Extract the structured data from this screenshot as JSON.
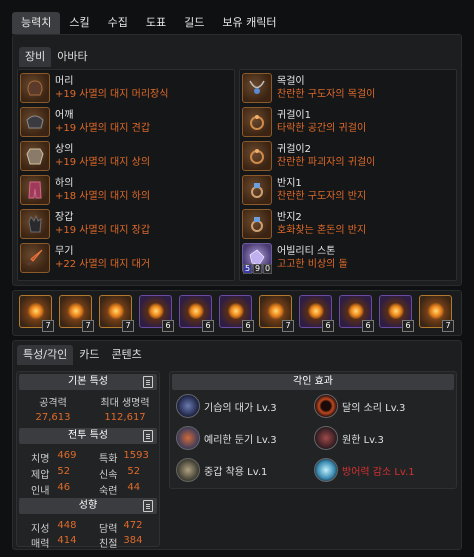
{
  "top_tabs": [
    "능력치",
    "스킬",
    "수집",
    "도표",
    "길드",
    "보유 캐릭터"
  ],
  "equip_tabs": [
    "장비",
    "아바타"
  ],
  "equipment_left": [
    {
      "name": "머리",
      "desc": "+19 사멸의 대지 머리장식",
      "icon": "helmet-icon"
    },
    {
      "name": "어깨",
      "desc": "+19 사멸의 대지 견갑",
      "icon": "shoulder-icon"
    },
    {
      "name": "상의",
      "desc": "+19 사멸의 대지 상의",
      "icon": "chest-armor-icon"
    },
    {
      "name": "하의",
      "desc": "+18 사멸의 대지 하의",
      "icon": "pants-icon"
    },
    {
      "name": "장갑",
      "desc": "+19 사멸의 대지 장갑",
      "icon": "gloves-icon"
    },
    {
      "name": "무기",
      "desc": "+22 사멸의 대지 대거",
      "icon": "dagger-icon"
    }
  ],
  "equipment_right": [
    {
      "name": "목걸이",
      "desc": "찬란한 구도자의 목걸이",
      "icon": "necklace-icon"
    },
    {
      "name": "귀걸이1",
      "desc": "타락한 공간의 귀걸이",
      "icon": "earring-icon"
    },
    {
      "name": "귀걸이2",
      "desc": "찬란한 파괴자의 귀걸이",
      "icon": "earring-icon"
    },
    {
      "name": "반지1",
      "desc": "찬란한 구도자의 반지",
      "icon": "ring-icon"
    },
    {
      "name": "반지2",
      "desc": "호화찾는 혼돈의 반지",
      "icon": "ring-icon"
    },
    {
      "name": "어빌리티 스톤",
      "desc": "고고한 비상의 돌",
      "icon": "ability-stone-icon",
      "badges": [
        "5",
        "9",
        "0"
      ]
    }
  ],
  "gems": [
    {
      "level": "7",
      "color": "orange"
    },
    {
      "level": "7",
      "color": "orange"
    },
    {
      "level": "7",
      "color": "orange"
    },
    {
      "level": "6",
      "color": "purple"
    },
    {
      "level": "6",
      "color": "purple"
    },
    {
      "level": "6",
      "color": "purple"
    },
    {
      "level": "7",
      "color": "orange"
    },
    {
      "level": "6",
      "color": "purple"
    },
    {
      "level": "6",
      "color": "purple"
    },
    {
      "level": "6",
      "color": "purple"
    },
    {
      "level": "7",
      "color": "orange"
    }
  ],
  "bottom_tabs": [
    "특성/각인",
    "카드",
    "콘텐츠"
  ],
  "basic_stats": {
    "title": "기본 특성",
    "attack_label": "공격력",
    "attack_value": "27,613",
    "hp_label": "최대 생명력",
    "hp_value": "112,617"
  },
  "combat_stats": {
    "title": "전투 특성",
    "items": [
      {
        "label": "치명",
        "value": "469"
      },
      {
        "label": "특화",
        "value": "1593"
      },
      {
        "label": "제압",
        "value": "52"
      },
      {
        "label": "신속",
        "value": "52"
      },
      {
        "label": "인내",
        "value": "46"
      },
      {
        "label": "숙련",
        "value": "44"
      }
    ]
  },
  "tendency": {
    "title": "성향",
    "items": [
      {
        "label": "지성",
        "value": "448"
      },
      {
        "label": "담력",
        "value": "472"
      },
      {
        "label": "매력",
        "value": "414"
      },
      {
        "label": "친절",
        "value": "384"
      }
    ]
  },
  "engravings": {
    "title": "각인 효과",
    "items": [
      {
        "name": "기습의 대가 Lv.3",
        "icon": "ambush-icon",
        "negative": false
      },
      {
        "name": "달의 소리 Lv.3",
        "icon": "moon-sound-icon",
        "negative": false
      },
      {
        "name": "예리한 둔기 Lv.3",
        "icon": "keen-blunt-icon",
        "negative": false
      },
      {
        "name": "원한 Lv.3",
        "icon": "grudge-icon",
        "negative": false
      },
      {
        "name": "중갑 착용 Lv.1",
        "icon": "heavy-armor-icon",
        "negative": false
      },
      {
        "name": "방어력 감소 Lv.1",
        "icon": "defense-down-icon",
        "negative": true
      }
    ]
  },
  "colors": {
    "accent_orange": "#e06a2a",
    "negative_red": "#d83030",
    "panel_bg": "#1d1e20"
  }
}
